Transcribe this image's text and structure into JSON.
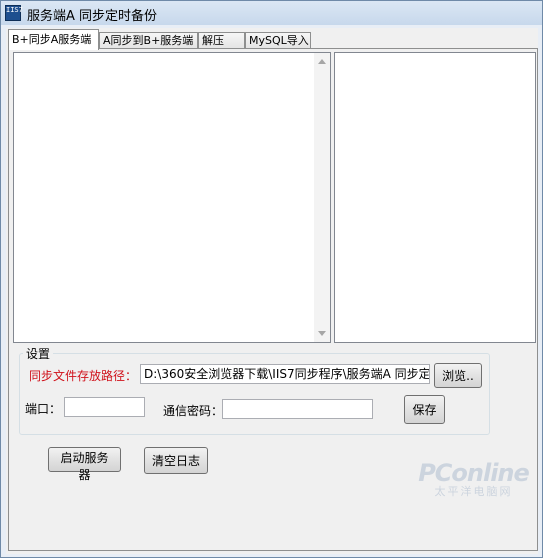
{
  "window": {
    "title": "服务端A 同步定时备份",
    "icon_text": "IIS7"
  },
  "tabs": [
    {
      "label": "B+同步A服务端",
      "active": true
    },
    {
      "label": "A同步到B+服务端",
      "active": false
    },
    {
      "label": "解压",
      "active": false
    },
    {
      "label": "MySQL导入",
      "active": false
    }
  ],
  "settings": {
    "group_title": "设置",
    "path_label": "同步文件存放路径：",
    "path_value": "D:\\360安全浏览器下载\\IIS7同步程序\\服务端A 同步定时",
    "browse_label": "浏览..",
    "port_label": "端口：",
    "port_value": "",
    "password_label": "通信密码：",
    "password_value": "",
    "save_label": "保存"
  },
  "actions": {
    "start_label": "启动服务器",
    "clear_label": "清空日志"
  },
  "watermark": {
    "main": "PConline",
    "sub": "太平洋电脑网"
  },
  "colors": {
    "path_label": "#d0121b"
  }
}
